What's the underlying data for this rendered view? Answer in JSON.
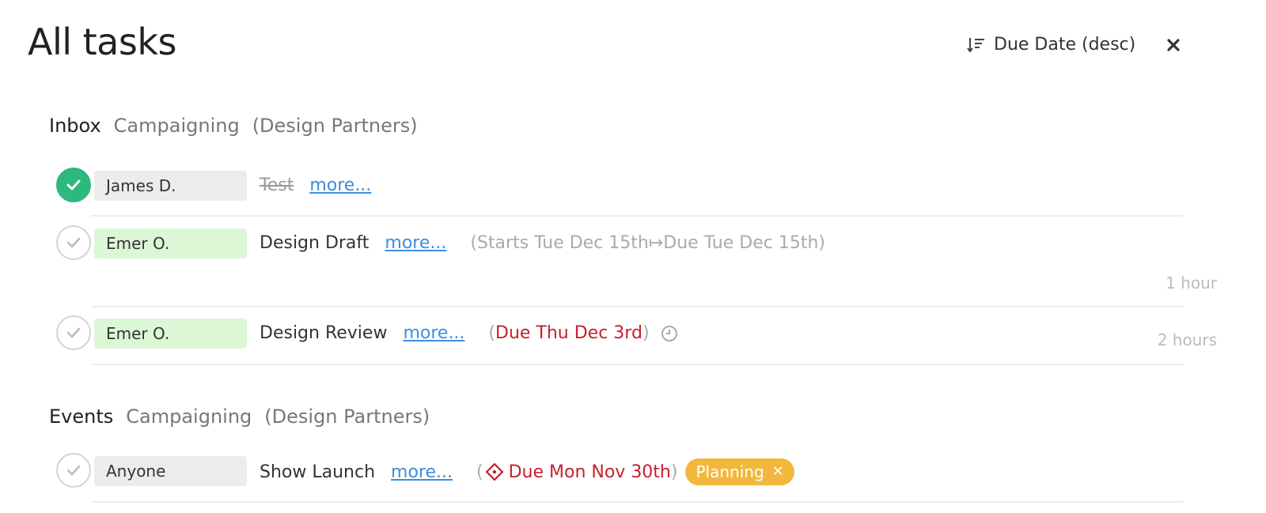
{
  "page": {
    "title": "All tasks"
  },
  "header": {
    "sort_label": "Due Date (desc)",
    "sort_icon": "sort-desc-icon",
    "close_icon": "close-icon"
  },
  "groups": [
    {
      "name": "Inbox",
      "project": "Campaigning",
      "client": "(Design Partners)",
      "tasks": [
        {
          "assignee": "James D.",
          "assignee_color": "#ececec",
          "completed": true,
          "name": "Test",
          "more": "more..."
        },
        {
          "assignee": "Emer O.",
          "assignee_color": "#dcf7d6",
          "completed": false,
          "name": "Design Draft",
          "more": "more...",
          "dates": "(Starts Tue Dec 15th↦Due Tue Dec 15th)",
          "duration": "1 hour"
        },
        {
          "assignee": "Emer O.",
          "assignee_color": "#dcf7d6",
          "completed": false,
          "name": "Design Review",
          "more": "more...",
          "due": "Due Thu Dec 3rd",
          "duration": "2 hours"
        }
      ]
    },
    {
      "name": "Events",
      "project": "Campaigning",
      "client": "(Design Partners)",
      "tasks": [
        {
          "assignee": "Anyone",
          "assignee_color": "#ececec",
          "completed": false,
          "name": "Show Launch",
          "more": "more...",
          "due": "Due Mon Nov 30th",
          "tag": "Planning",
          "tag_color": "#f2b73c"
        }
      ]
    }
  ],
  "colors": {
    "done_green": "#2db87d",
    "link_blue": "#3d8ee0",
    "overdue_red": "#c8202b",
    "tag_orange": "#f2b73c"
  }
}
